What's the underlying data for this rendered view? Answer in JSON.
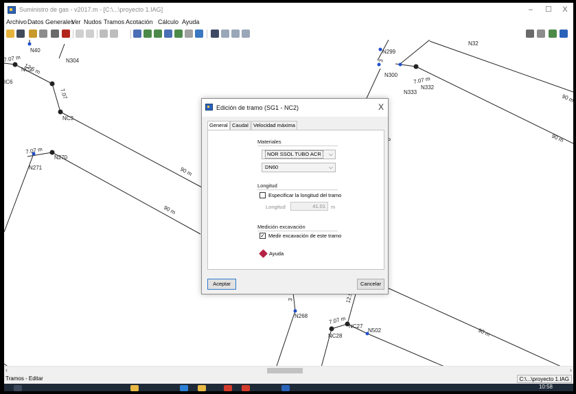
{
  "window": {
    "title": "Suministro de gas - v2017.m - [C:\\...\\proyecto 1.IAG]",
    "minimize": "–",
    "maximize": "☐",
    "close": "X"
  },
  "menu": [
    "Archivo",
    "Datos Generales",
    "Ver",
    "Nudos",
    "Tramos",
    "Acotación",
    "Cálculo",
    "Ayuda"
  ],
  "canvas": {
    "node_labels": {
      "n40": "N40",
      "n304": "N304",
      "ic6": "IC6",
      "nc2": "NC2",
      "nc3": "NC3",
      "n271": "N271",
      "n270": "N270",
      "n299": "N299",
      "n300": "N300",
      "n333": "N333",
      "n332": "N332",
      "n32x": "N32",
      "n268": "N268",
      "nc27": "NC27",
      "nc28": "NC28",
      "n502": "N502"
    },
    "dim_labels": {
      "d_125_top": "12.5 m",
      "d_7_top": "7.07 m",
      "d_7_nc2": "7.07",
      "d_707_left": "7.07 m",
      "d_90_a": "90 m",
      "d_90_b": "90 m",
      "d_90_c": "90 m",
      "d_90_d": "90 m",
      "d_90_e": "90 m",
      "d_707_right": "7.07 m",
      "d_707_bottom": "7.07 m",
      "d_125_bottom": "12.5",
      "d_3_bottom": "3",
      "d_3_top": "3",
      "d_6": "6",
      "d_7_left": "7.07 m"
    }
  },
  "dialog": {
    "title": "Edición de tramo (SG1 - NC2)",
    "close": "X",
    "tabs": [
      "General",
      "Caudal",
      "Velocidad máxima"
    ],
    "materiales": {
      "label": "Materiales",
      "material": "NOR SSOL TUBO ACR",
      "diameter": "DN60"
    },
    "longitud": {
      "label": "Longitud",
      "checkbox_label": "Especificar la longitud del tramo",
      "checked": false,
      "field_label": "Longitud",
      "value": "41.01",
      "unit": "m"
    },
    "excavacion": {
      "label": "Medición excavación",
      "checkbox_label": "Medir excavación de este tramo",
      "checked": true
    },
    "help_label": "Ayuda",
    "ok_label": "Aceptar",
    "cancel_label": "Cancelar"
  },
  "status": {
    "left": "Tramos - Editar",
    "right": "C:\\...\\proyecto 1.IAG"
  },
  "taskbar": {
    "time": "10:58"
  },
  "colors": {
    "node_blue": "#1f4fc9",
    "node_black": "#222222",
    "accent_blue": "#2a62b9",
    "taskbar": "#1f2a38"
  }
}
